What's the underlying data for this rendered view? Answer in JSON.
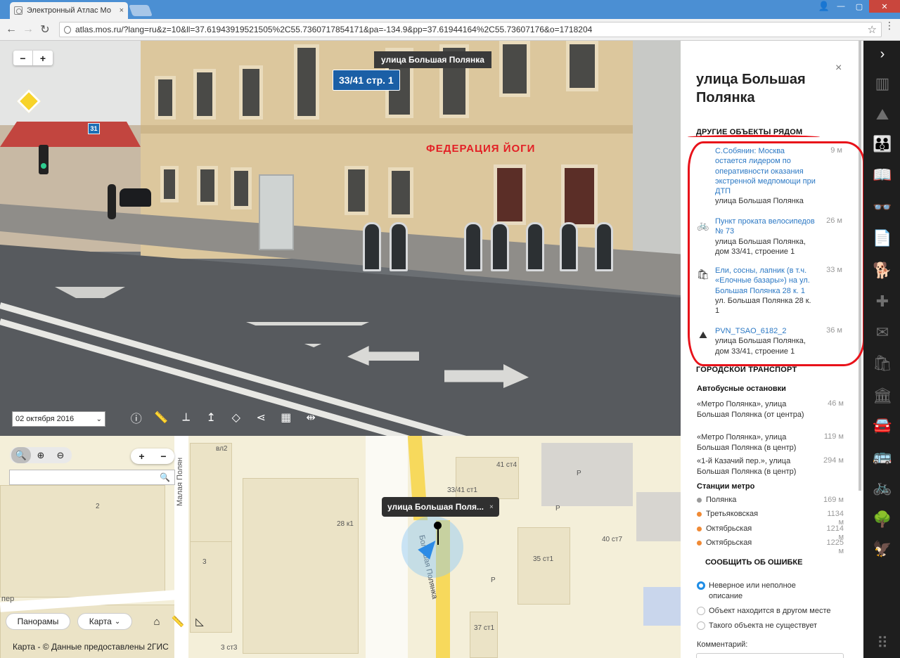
{
  "browser": {
    "tab_title": "Электронный Атлас Мо",
    "tab_close": "×",
    "url": "atlas.mos.ru/?lang=ru&z=10&ll=37.61943919521505%2C55.7360717854171&pa=-134.9&pp=37.61944164%2C55.73607176&o=1718204",
    "window_min": "—",
    "window_max": "▢",
    "window_close": "✕",
    "nav": {
      "back": "←",
      "forward": "→",
      "reload": "↻"
    },
    "star": "☆",
    "menu": "⋮"
  },
  "panorama": {
    "street_label": "улица Большая Полянка",
    "house_number": "33/41  стр. 1",
    "shop_sign": "ФЕДЕРАЦИЯ ЙОГИ",
    "zoom_out": "−",
    "zoom_in": "+",
    "date": "02 октября 2016",
    "date_arrow": "⌄",
    "house_31": "31",
    "tools": [
      {
        "name": "info-icon",
        "glyph": "ⓘ"
      },
      {
        "name": "ruler-icon",
        "glyph": "📏"
      },
      {
        "name": "angle-icon",
        "glyph": "⟂"
      },
      {
        "name": "height-icon",
        "glyph": "↥"
      },
      {
        "name": "area-icon",
        "glyph": "◇"
      },
      {
        "name": "share-icon",
        "glyph": "⋖"
      },
      {
        "name": "grid-icon",
        "glyph": "▦"
      },
      {
        "name": "split-icon",
        "glyph": "⇹"
      }
    ]
  },
  "map": {
    "tools": {
      "search": "🔍",
      "zoom_in": "⊕",
      "zoom_out": "⊖"
    },
    "zoom_in": "+",
    "zoom_out": "−",
    "search_icon": "🔍",
    "tooltip": "улица Большая Поля...",
    "tooltip_close": "×",
    "buttons": {
      "panoramas": "Панорамы",
      "map": "Карта",
      "map_arrow": "⌄"
    },
    "copyright": "Карта - © Данные предоставлены 2ГИС",
    "labels": {
      "malaya_polyanka": "Малая Полян",
      "vl2": "вл2",
      "n2": "2",
      "n28k1": "28 к1",
      "n3": "3",
      "n33_41": "33/41 ст1",
      "n41st4": "41 ст4",
      "n40st7": "40 ст7",
      "n35st1": "35 ст1",
      "n37st1": "37 ст1",
      "n3st3": "3 ст3",
      "per": "пер",
      "bolshaya": "Большая Полянка",
      "r1": "Р",
      "r2": "Р",
      "r3": "Р"
    }
  },
  "panel": {
    "close": "×",
    "title": "улица Большая Полянка",
    "nearby_header": "ДРУГИЕ ОБЪЕКТЫ РЯДОМ",
    "nearby": [
      {
        "icon": "news-icon",
        "glyph": "",
        "title": "С.Собянин: Москва остается лидером по оперативности оказания экстренной медпомощи при ДТП",
        "address": "улица Большая Полянка",
        "distance": "9 м"
      },
      {
        "icon": "bicycle-icon",
        "glyph": "🚲",
        "title": "Пункт проката велосипедов № 73",
        "address": "улица Большая Полянка, дом 33/41, строение 1",
        "distance": "26 м"
      },
      {
        "icon": "shopping-bag-icon",
        "glyph": "🛍",
        "title": "Ели, сосны, лапник (в т.ч. «Елочные базары») на ул. Большая Полянка 28 к. 1",
        "address": "ул. Большая Полянка 28 к. 1",
        "distance": "33 м"
      },
      {
        "icon": "map-marker-icon",
        "glyph": "⛰",
        "title": "PVN_TSAO_6182_2",
        "address": "улица Большая Полянка, дом 33/41, строение 1",
        "distance": "36 м"
      }
    ],
    "transport_header": "ГОРОДСКОЙ ТРАНСПОРТ",
    "bus_header": "Автобусные остановки",
    "bus_stops": [
      {
        "name": "«Метро Полянка», улица Большая Полянка (от центра)",
        "distance": "46 м"
      },
      {
        "name": "«Метро Полянка», улица Большая Полянка (в центр)",
        "distance": "119 м"
      },
      {
        "name": "«1-й Казачий пер.», улица Большая Полянка (в центр)",
        "distance": "294 м"
      }
    ],
    "metro_header": "Станции метро",
    "metro": [
      {
        "name": "Полянка",
        "distance": "169 м",
        "color": "#9a9a9a"
      },
      {
        "name": "Третьяковская",
        "distance": "1134 м",
        "color": "#f08a35"
      },
      {
        "name": "Октябрьская",
        "distance": "1214 м",
        "color": "#f08a35"
      },
      {
        "name": "Октябрьская",
        "distance": "1225 м",
        "color": "#f08a35"
      }
    ],
    "report_header": "СООБЩИТЬ ОБ ОШИБКЕ",
    "report_options": [
      {
        "label": "Неверное или неполное описание",
        "selected": true
      },
      {
        "label": "Объект находится в другом месте",
        "selected": false
      },
      {
        "label": "Такого объекта не существует",
        "selected": false
      }
    ],
    "comment_label": "Комментарий:"
  },
  "sidebar": {
    "icons": [
      {
        "name": "chevron-right-icon",
        "glyph": "›"
      },
      {
        "name": "building-icon",
        "glyph": "▥"
      },
      {
        "name": "map-layers-icon",
        "glyph": "⛰"
      },
      {
        "name": "people-icon",
        "glyph": "👪"
      },
      {
        "name": "book-icon",
        "glyph": "📖"
      },
      {
        "name": "glasses-icon",
        "glyph": "👓"
      },
      {
        "name": "document-icon",
        "glyph": "📄"
      },
      {
        "name": "dog-icon",
        "glyph": "🐕"
      },
      {
        "name": "medical-cross-icon",
        "glyph": "✚"
      },
      {
        "name": "vote-icon",
        "glyph": "✉"
      },
      {
        "name": "shopping-bags-icon",
        "glyph": "🛍"
      },
      {
        "name": "museum-icon",
        "glyph": "🏛"
      },
      {
        "name": "car-icon",
        "glyph": "🚘"
      },
      {
        "name": "bus-icon",
        "glyph": "🚌"
      },
      {
        "name": "bicycle-icon",
        "glyph": "🚲"
      },
      {
        "name": "tree-icon",
        "glyph": "🌳"
      },
      {
        "name": "coat-of-arms-icon",
        "glyph": "🦅"
      },
      {
        "name": "apps-grid-icon",
        "glyph": "⠿"
      }
    ]
  },
  "colors": {
    "link": "#2b78c4",
    "annotation_red": "#e8121a",
    "sidebar_bg": "#1e1e1e",
    "radio_selected": "#1e8de6"
  }
}
